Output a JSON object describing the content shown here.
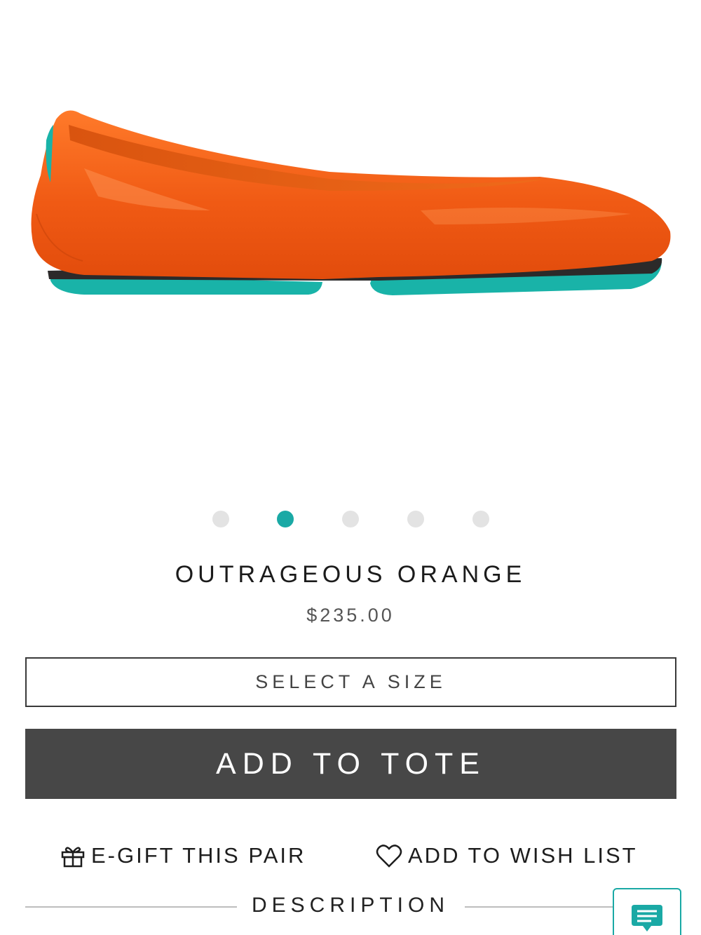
{
  "product": {
    "name": "OUTRAGEOUS ORANGE",
    "price": "$235.00",
    "image_icon": "orange-ballet-flat-image"
  },
  "carousel": {
    "count": 5,
    "active_index": 1
  },
  "size_select": {
    "label": "SELECT A SIZE"
  },
  "add_to_tote": {
    "label": "ADD TO TOTE"
  },
  "actions": {
    "egift": {
      "label": "E-GIFT THIS PAIR",
      "icon": "gift-icon"
    },
    "wishlist": {
      "label": "ADD TO WISH LIST",
      "icon": "heart-icon"
    }
  },
  "description": {
    "label": "DESCRIPTION"
  },
  "chat": {
    "icon": "chat-icon"
  },
  "colors": {
    "accent": "#1aa9a5",
    "button": "#474747",
    "shoe": "#f2601c",
    "sole": "#19b3a8"
  }
}
